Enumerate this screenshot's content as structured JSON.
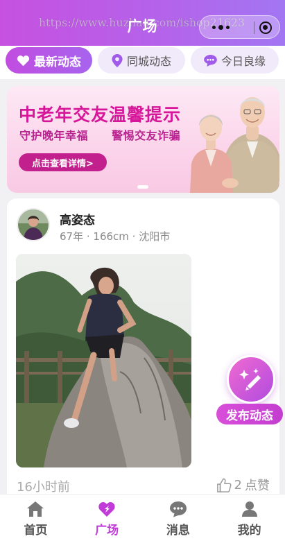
{
  "header": {
    "title": "广场",
    "watermark": "https://www.huzhan.com/ishop21623"
  },
  "tabs": [
    {
      "label": "最新动态",
      "icon": "heart-icon",
      "active": true
    },
    {
      "label": "同城动态",
      "icon": "location-pin-icon",
      "active": false
    },
    {
      "label": "今日良缘",
      "icon": "chat-bubble-icon",
      "active": false
    }
  ],
  "banner": {
    "title": "中老年交友温馨提示",
    "subtitle_left": "守护晚年幸福",
    "subtitle_right": "警惕交友诈骗",
    "button_label": "点击查看详情>"
  },
  "post": {
    "user_name": "高姿态",
    "age": "67年",
    "height": "166cm",
    "city": "沈阳市",
    "meta_separator": " · ",
    "time": "16小时前",
    "like_count": "2",
    "like_label": "点赞"
  },
  "fab": {
    "label": "发布动态",
    "icon": "pencil-sparkle-icon"
  },
  "bottom_nav": [
    {
      "label": "首页",
      "icon": "home-icon",
      "active": false
    },
    {
      "label": "广场",
      "icon": "square-icon",
      "active": true
    },
    {
      "label": "消息",
      "icon": "message-icon",
      "active": false
    },
    {
      "label": "我的",
      "icon": "profile-icon",
      "active": false
    }
  ],
  "colors": {
    "accent": "#c14de0",
    "accent_secondary": "#a764ee",
    "banner_title": "#d6179a",
    "muted_text": "#888888"
  }
}
